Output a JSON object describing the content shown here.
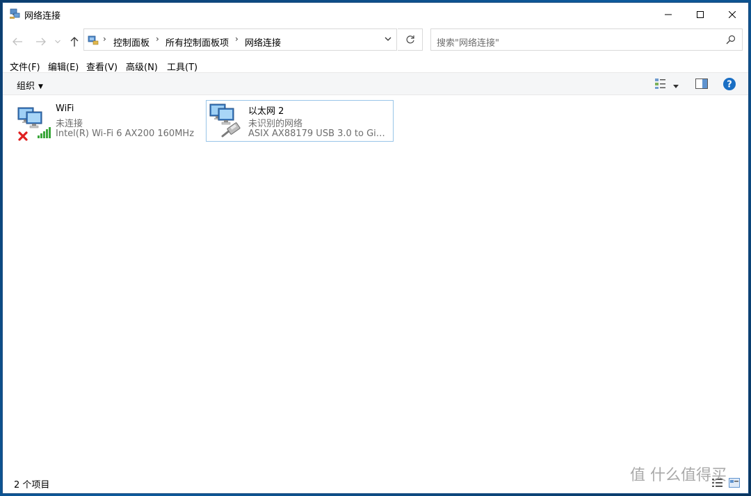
{
  "window": {
    "title": "网络连接"
  },
  "nav": {
    "back_icon": "arrow-left-icon",
    "forward_icon": "arrow-right-icon",
    "recent_icon": "chevron-down-icon",
    "up_icon": "arrow-up-icon"
  },
  "address": {
    "crumbs": [
      "控制面板",
      "所有控制面板项",
      "网络连接"
    ],
    "separator": "›"
  },
  "search": {
    "placeholder": "搜索\"网络连接\""
  },
  "menu": {
    "items": [
      "文件(F)",
      "编辑(E)",
      "查看(V)",
      "高级(N)",
      "工具(T)"
    ]
  },
  "toolbar": {
    "organize_label": "组织",
    "help_label": "?"
  },
  "connections": [
    {
      "name": "WiFi",
      "status": "未连接",
      "device": "Intel(R) Wi-Fi 6 AX200 160MHz",
      "icon": "wifi-network-icon",
      "state": "disconnected"
    },
    {
      "name": "以太网 2",
      "status": "未识别的网络",
      "device": "ASIX AX88179 USB 3.0 to Giga...",
      "icon": "ethernet-network-icon",
      "state": "selected"
    }
  ],
  "statusbar": {
    "count": "2 个项目"
  },
  "watermark": {
    "text": "值 什么值得买"
  },
  "colors": {
    "accent": "#1a6fc4",
    "selection_border": "#99c5e8",
    "error_red": "#e02020",
    "signal_green": "#3aa63a",
    "window_frame": "#1e4f82"
  }
}
